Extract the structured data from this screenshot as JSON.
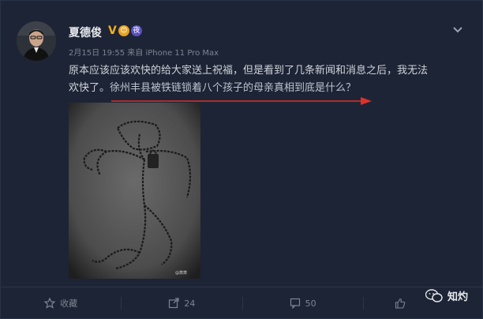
{
  "post": {
    "author": "夏德俊",
    "verified_badge": "V",
    "badge_2": "😊",
    "badge_3": "夜",
    "date": "2月15日",
    "time": "19:55",
    "source_prefix": "来自",
    "source": "iPhone 11 Pro Max",
    "text_line1": "原本应该应该欢快的给大家送上祝福，但是看到了几条新闻和消息之后，我无法",
    "text_line2_part1": "欢快了。",
    "text_line2_part2": "徐州丰县被铁链锁着八个孩子的母亲真相到底是什么？",
    "image_watermark": "@萧萧"
  },
  "footer": {
    "favorite_label": "收藏",
    "repost_count": "24",
    "comment_count": "50",
    "like_label": ""
  },
  "watermark": {
    "brand": "知灼"
  },
  "colors": {
    "background": "#1d2435",
    "annotation_arrow": "#e0302a",
    "verified": "#f2b01c",
    "link_text": "#bcc3d0"
  },
  "icons": [
    "chevron-down-icon",
    "favorite-icon",
    "repost-icon",
    "comment-icon",
    "like-icon",
    "wechat-icon"
  ]
}
